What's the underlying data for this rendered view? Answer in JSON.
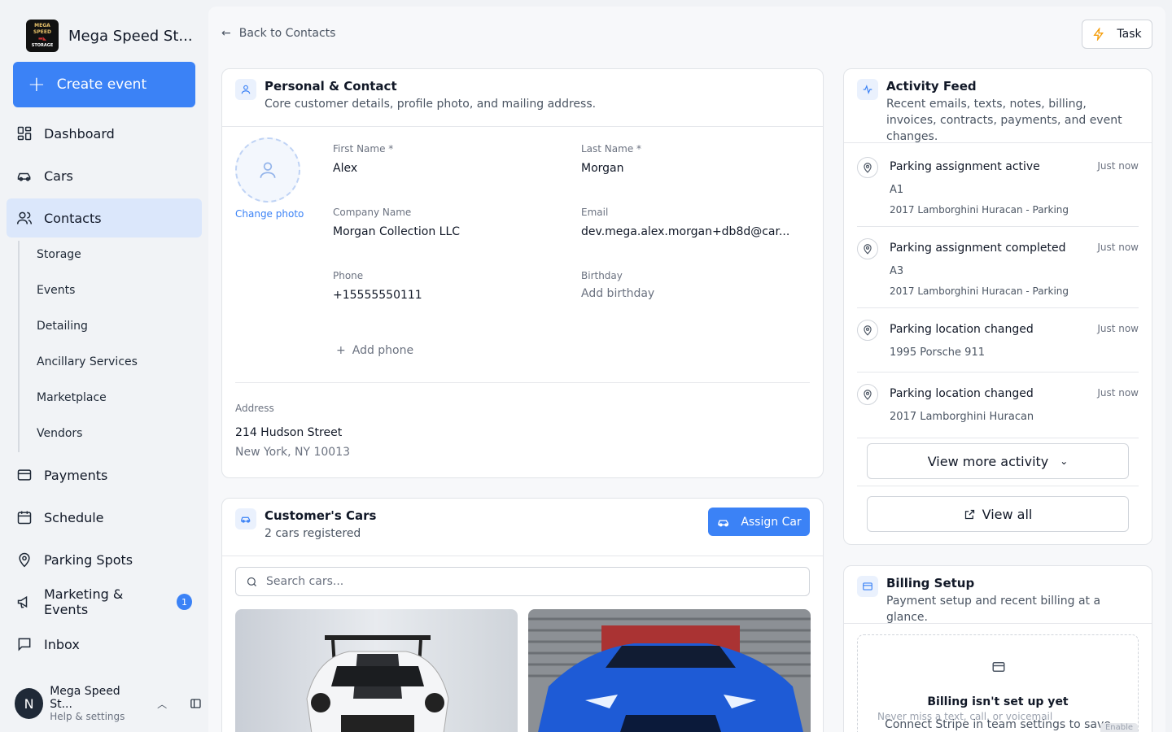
{
  "brand": {
    "name": "Mega Speed St...",
    "logo_text": [
      "MEGA SPEED",
      "STORAGE"
    ]
  },
  "sidebar": {
    "create_label": "Create event",
    "items": [
      {
        "label": "Dashboard",
        "icon": "dashboard-icon"
      },
      {
        "label": "Cars",
        "icon": "car-icon"
      },
      {
        "label": "Contacts",
        "icon": "users-icon"
      },
      {
        "label": "Payments",
        "icon": "card-icon"
      },
      {
        "label": "Schedule",
        "icon": "calendar-icon"
      },
      {
        "label": "Parking Spots",
        "icon": "map-pin-icon"
      },
      {
        "label": "Marketing & Events",
        "icon": "megaphone-icon",
        "badge": "1"
      },
      {
        "label": "Inbox",
        "icon": "message-icon"
      }
    ],
    "subitems": [
      "Storage",
      "Events",
      "Detailing",
      "Ancillary Services",
      "Marketplace",
      "Vendors"
    ]
  },
  "user": {
    "initial": "N",
    "name": "Mega Speed St...",
    "sub": "Help & settings"
  },
  "header": {
    "back_label": "Back to Contacts",
    "task_label": "Task"
  },
  "personal": {
    "title": "Personal & Contact",
    "subtitle": "Core customer details, profile photo, and mailing address.",
    "change_photo": "Change photo",
    "first_name_label": "First Name *",
    "first_name": "Alex",
    "last_name_label": "Last Name *",
    "last_name": "Morgan",
    "company_label": "Company Name",
    "company": "Morgan Collection LLC",
    "email_label": "Email",
    "email": "dev.mega.alex.morgan+db8d@car...",
    "phone_label": "Phone",
    "phone": "+15555550111",
    "birthday_label": "Birthday",
    "birthday": "Add birthday",
    "add_phone": "Add phone",
    "address_label": "Address",
    "address_line1": "214 Hudson Street",
    "address_line2": "New York, NY 10013"
  },
  "cars": {
    "title": "Customer's Cars",
    "subtitle": "2 cars registered",
    "assign_label": "Assign Car",
    "search_placeholder": "Search cars..."
  },
  "activity": {
    "title": "Activity Feed",
    "subtitle": "Recent emails, texts, notes, billing, invoices, contracts, payments, and event changes.",
    "items": [
      {
        "title": "Parking assignment active",
        "time": "Just now",
        "line1": "A1",
        "line2": "2017 Lamborghini Huracan - Parking"
      },
      {
        "title": "Parking assignment completed",
        "time": "Just now",
        "line1": "A3",
        "line2": "2017 Lamborghini Huracan - Parking"
      },
      {
        "title": "Parking location changed",
        "time": "Just now",
        "line1": "1995 Porsche 911"
      },
      {
        "title": "Parking location changed",
        "time": "Just now",
        "line1": "2017 Lamborghini Huracan"
      }
    ],
    "view_more": "View more activity",
    "view_all": "View all"
  },
  "billing": {
    "title": "Billing Setup",
    "subtitle": "Payment setup and recent billing at a glance.",
    "empty_title": "Billing isn't set up yet",
    "empty_text": "Connect Stripe in team settings to save",
    "overlay_text": "Never miss a text, call, or voicemail",
    "overlay_button": "Enable"
  },
  "colors": {
    "accent": "#3b82f6",
    "active_nav": "#dbe7fb"
  }
}
